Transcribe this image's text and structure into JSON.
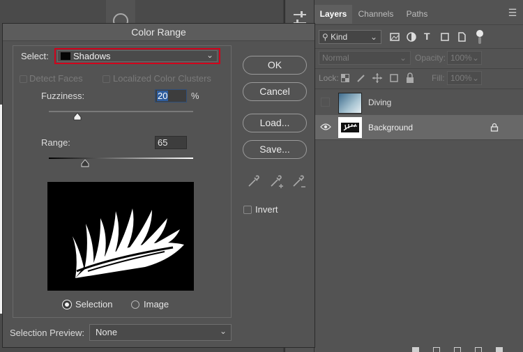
{
  "layers_panel": {
    "tabs": [
      "Layers",
      "Channels",
      "Paths"
    ],
    "filter_kind": "Kind",
    "blend_mode": "Normal",
    "opacity_label": "Opacity:",
    "opacity_value": "100%",
    "lock_label": "Lock:",
    "fill_label": "Fill:",
    "fill_value": "100%",
    "layers": [
      {
        "name": "Diving",
        "visible": false,
        "selected": false
      },
      {
        "name": "Background",
        "visible": true,
        "selected": true,
        "locked": true
      }
    ]
  },
  "dialog": {
    "title": "Color Range",
    "select_label": "Select:",
    "select_value": "Shadows",
    "detect_faces_label": "Detect Faces",
    "localized_label": "Localized Color Clusters",
    "fuzziness_label": "Fuzziness:",
    "fuzziness_value": "20",
    "fuzziness_unit": "%",
    "fuzziness_level": 0.2,
    "range_label": "Range:",
    "range_value": "65",
    "range_level": 0.25,
    "buttons": {
      "ok": "OK",
      "cancel": "Cancel",
      "load": "Load...",
      "save": "Save..."
    },
    "invert_label": "Invert",
    "selection_label": "Selection",
    "image_label": "Image",
    "preview_label": "Selection Preview:",
    "preview_value": "None"
  },
  "colors": {
    "highlight_border": "#d0021b",
    "accent_blue": "#2e5d9e"
  }
}
